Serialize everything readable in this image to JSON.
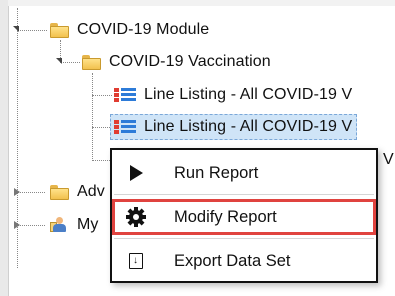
{
  "tree": {
    "covid_module": "COVID-19 Module",
    "covid_vaccination": "COVID-19 Vaccination",
    "line_listing_1": "Line Listing - All COVID-19 V",
    "line_listing_2": "Line Listing - All COVID-19 V",
    "partial_item_tail": "V",
    "adv_partial": "Adv",
    "my_partial": "My"
  },
  "context_menu": {
    "run_report": "Run Report",
    "modify_report": "Modify Report",
    "export_data_set": "Export Data Set",
    "icons": [
      "play-icon",
      "gear-icon",
      "export-icon"
    ]
  },
  "colors": {
    "selection_bg": "#cfe4f7",
    "highlight_border": "#e0433f",
    "folder_yellow": "#f2c14e",
    "list_icon_red": "#e03c31",
    "list_icon_blue": "#2d7bd8"
  }
}
